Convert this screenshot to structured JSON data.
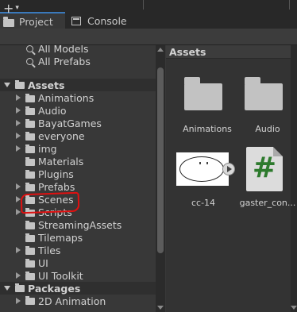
{
  "tabs": [
    {
      "label": "Project",
      "icon": "folder-icon",
      "active": true
    },
    {
      "label": "Console",
      "icon": "console-icon",
      "active": false
    }
  ],
  "toolbar": {
    "add_label": "+",
    "add_caret": "▾"
  },
  "tree": {
    "favorites": [
      "All Models",
      "All Prefabs"
    ],
    "assets_section": "Assets",
    "assets_children": [
      {
        "label": "Animations",
        "expandable": true
      },
      {
        "label": "Audio",
        "expandable": true
      },
      {
        "label": "BayatGames",
        "expandable": true
      },
      {
        "label": "everyone",
        "expandable": true
      },
      {
        "label": "img",
        "expandable": true
      },
      {
        "label": "Materials",
        "expandable": false
      },
      {
        "label": "Plugins",
        "expandable": false
      },
      {
        "label": "Prefabs",
        "expandable": true
      },
      {
        "label": "Scenes",
        "expandable": true
      },
      {
        "label": "Scripts",
        "expandable": true
      },
      {
        "label": "StreamingAssets",
        "expandable": false
      },
      {
        "label": "Tilemaps",
        "expandable": false
      },
      {
        "label": "Tiles",
        "expandable": true
      },
      {
        "label": "UI",
        "expandable": false
      },
      {
        "label": "UI Toolkit",
        "expandable": true
      }
    ],
    "packages_section": "Packages",
    "packages_children": [
      {
        "label": "2D Animation",
        "expandable": true
      }
    ]
  },
  "assets_panel": {
    "header": "Assets",
    "items": [
      {
        "label": "Animations",
        "kind": "folder"
      },
      {
        "label": "Audio",
        "kind": "folder"
      },
      {
        "label": "cc-14",
        "kind": "sprite"
      },
      {
        "label": "gaster_con...",
        "kind": "csharp-script",
        "glyph": "#"
      }
    ]
  },
  "colors": {
    "highlight_mark": "#e01010",
    "accent_tab": "#3a79bb",
    "script_glyph": "#2d7a2d"
  }
}
